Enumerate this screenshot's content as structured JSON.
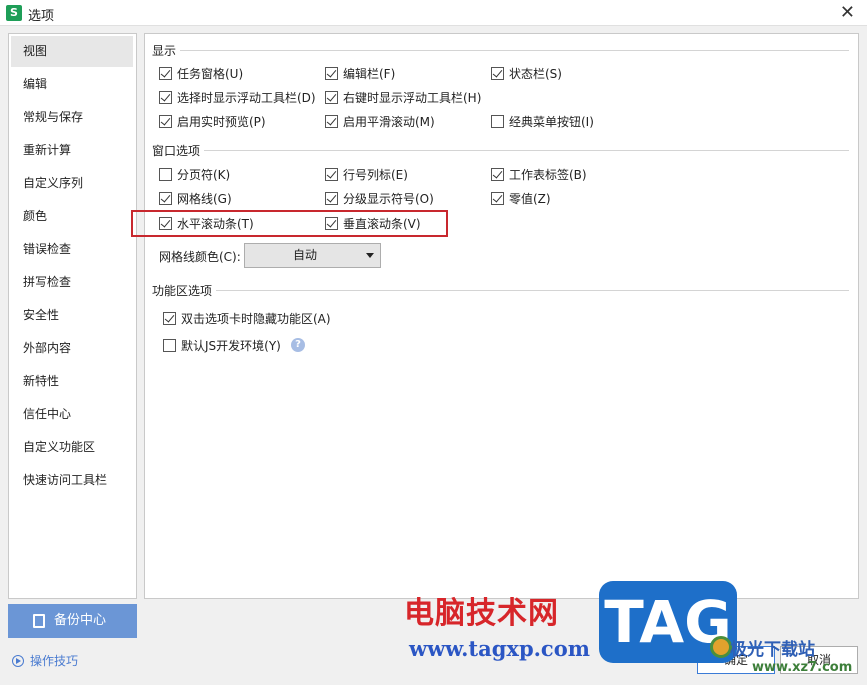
{
  "window": {
    "title": "选项",
    "app_icon_letter": "S",
    "close_glyph": "✕"
  },
  "sidebar": {
    "items": [
      {
        "label": "视图",
        "active": true
      },
      {
        "label": "编辑"
      },
      {
        "label": "常规与保存"
      },
      {
        "label": "重新计算"
      },
      {
        "label": "自定义序列"
      },
      {
        "label": "颜色"
      },
      {
        "label": "错误检查"
      },
      {
        "label": "拼写检查"
      },
      {
        "label": "安全性"
      },
      {
        "label": "外部内容"
      },
      {
        "label": "新特性"
      },
      {
        "label": "信任中心"
      },
      {
        "label": "自定义功能区"
      },
      {
        "label": "快速访问工具栏"
      }
    ],
    "backup_label": "备份中心",
    "tips_label": "操作技巧"
  },
  "display": {
    "title": "显示",
    "options": [
      {
        "label": "任务窗格(U)",
        "checked": true
      },
      {
        "label": "编辑栏(F)",
        "checked": true
      },
      {
        "label": "状态栏(S)",
        "checked": true
      },
      {
        "label": "选择时显示浮动工具栏(D)",
        "checked": true
      },
      {
        "label": "右键时显示浮动工具栏(H)",
        "checked": true
      },
      {
        "label": "启用实时预览(P)",
        "checked": true
      },
      {
        "label": "启用平滑滚动(M)",
        "checked": true
      },
      {
        "label": "经典菜单按钮(I)",
        "checked": false
      }
    ]
  },
  "window_options": {
    "title": "窗口选项",
    "options": [
      {
        "label": "分页符(K)",
        "checked": false
      },
      {
        "label": "行号列标(E)",
        "checked": true
      },
      {
        "label": "工作表标签(B)",
        "checked": true
      },
      {
        "label": "网格线(G)",
        "checked": true
      },
      {
        "label": "分级显示符号(O)",
        "checked": true
      },
      {
        "label": "零值(Z)",
        "checked": true
      },
      {
        "label": "水平滚动条(T)",
        "checked": true
      },
      {
        "label": "垂直滚动条(V)",
        "checked": true
      }
    ],
    "gridline_color_label": "网格线颜色(C):",
    "gridline_color_value": "自动"
  },
  "ribbon": {
    "title": "功能区选项",
    "options": [
      {
        "label": "双击选项卡时隐藏功能区(A)",
        "checked": true
      },
      {
        "label": "默认JS开发环境(Y)",
        "checked": false
      }
    ],
    "help_glyph": "?"
  },
  "buttons": {
    "ok_label": "确定",
    "cancel_label": "取消"
  },
  "watermark": {
    "cn_text": "电脑技术网",
    "url_text": "www.tagxp.com",
    "tag_text": "TAG",
    "site_text": "极光下载站",
    "site_url": "www.xz7.com"
  },
  "colors": {
    "highlight_border": "#c8282e",
    "backup_button": "#6b96d6",
    "app_icon": "#1e9e58"
  }
}
